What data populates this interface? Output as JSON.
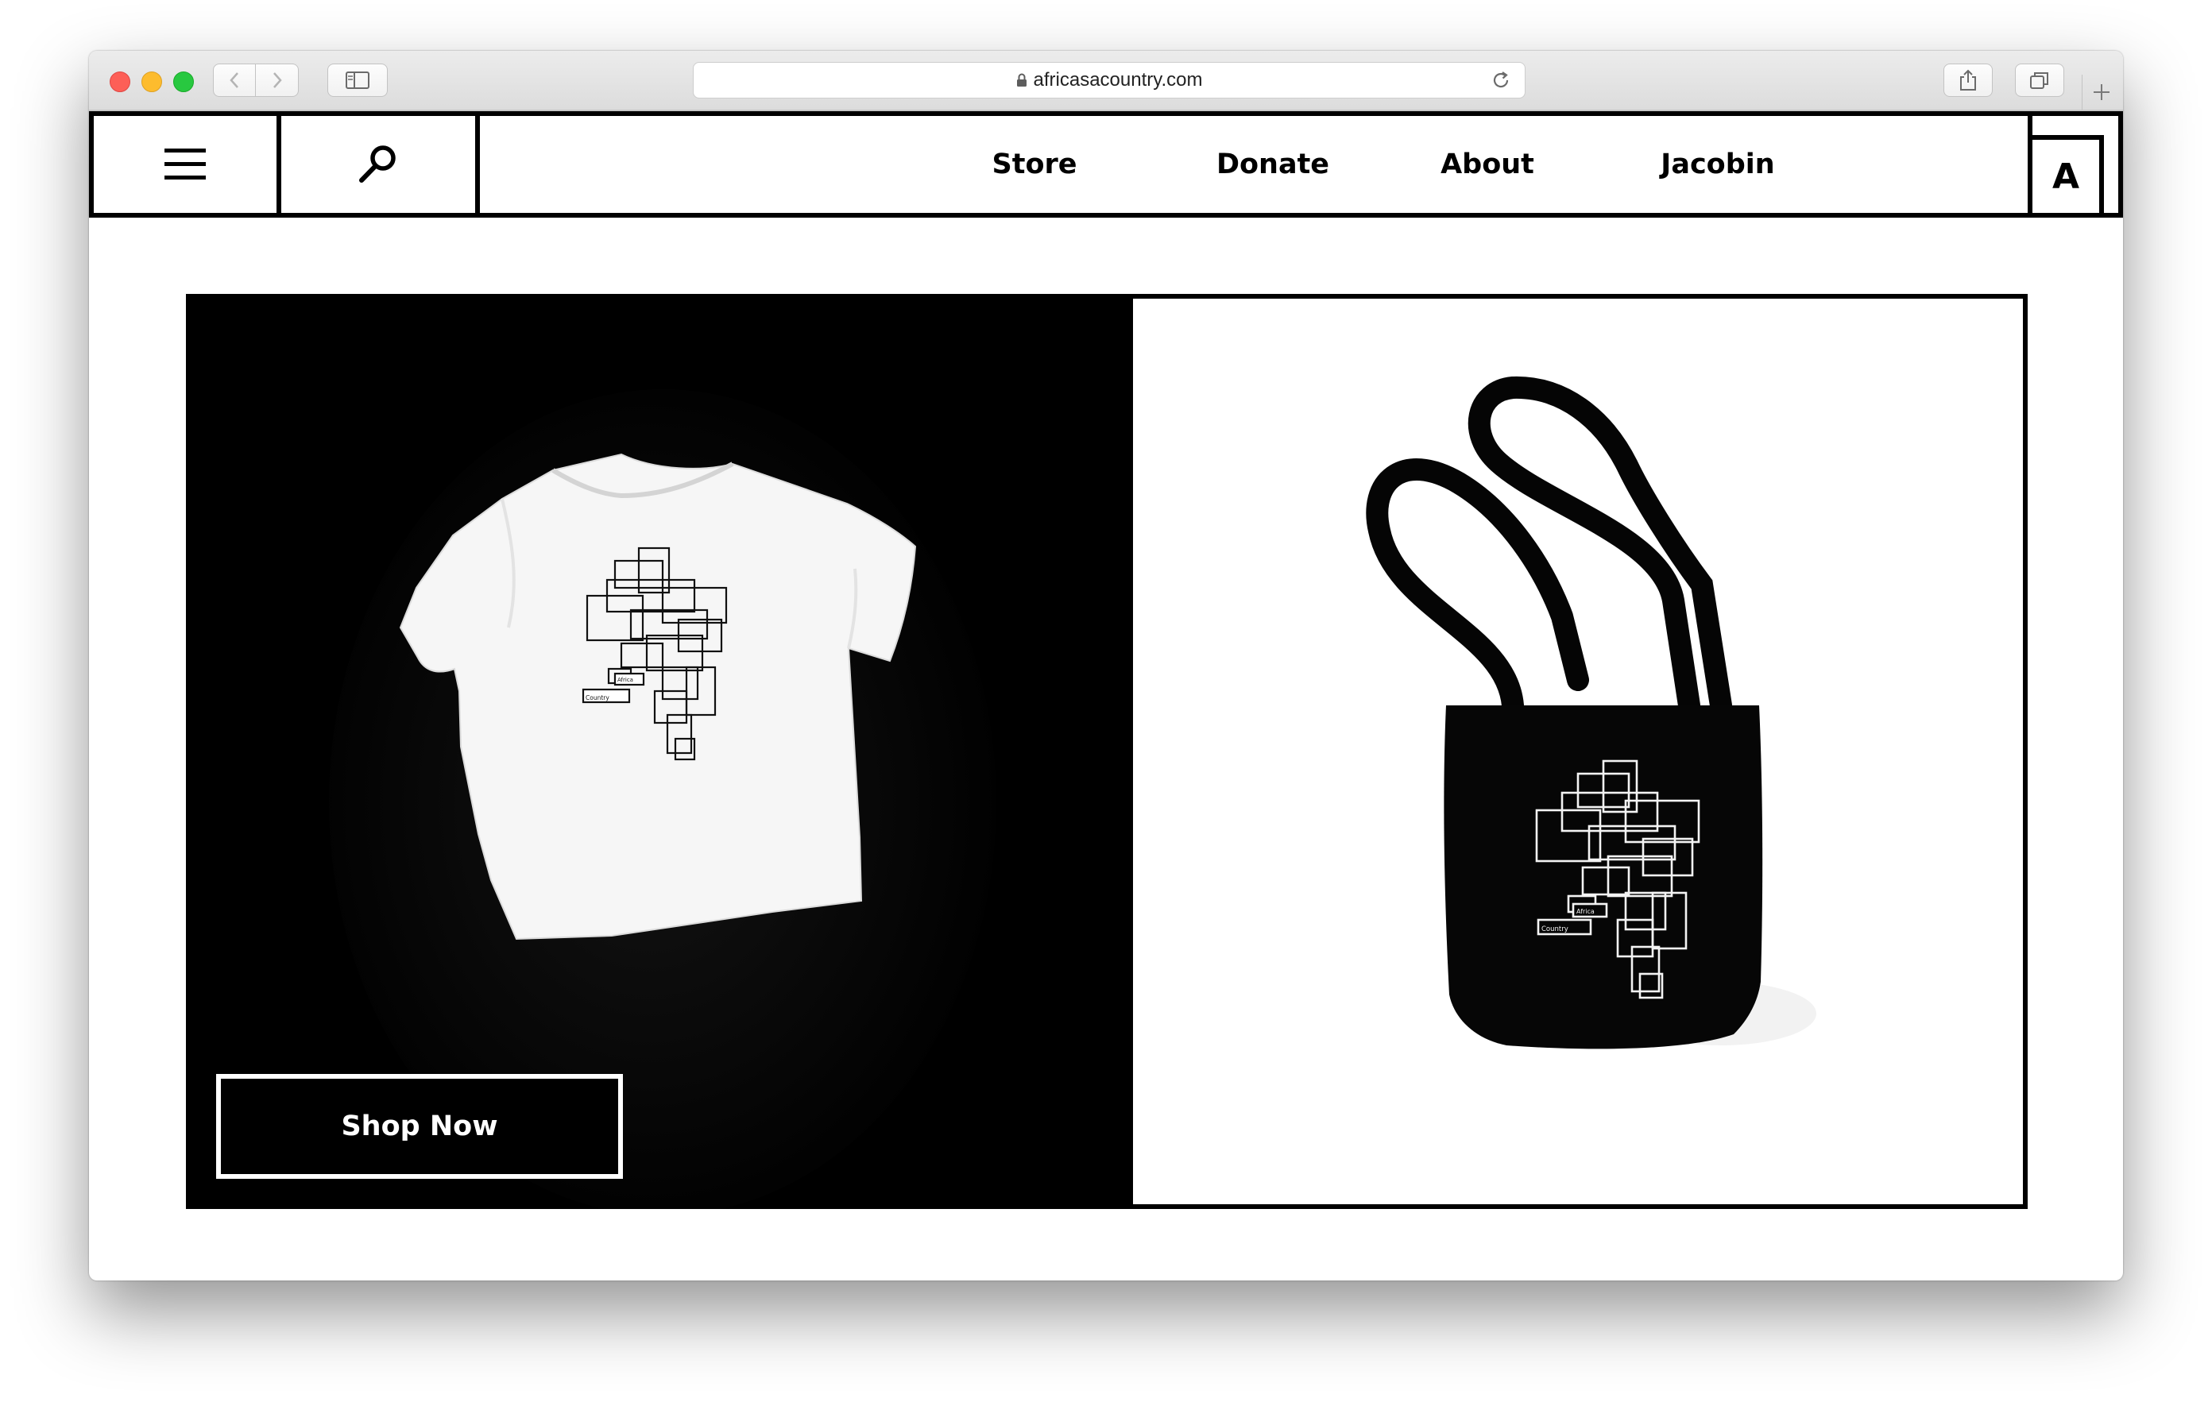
{
  "browser": {
    "url": "africasacountry.com",
    "icons": [
      "chevron-left-icon",
      "chevron-right-icon",
      "sidebar-icon",
      "lock-icon",
      "reload-icon",
      "share-icon",
      "tabs-icon",
      "plus-icon"
    ]
  },
  "header": {
    "menu_icon": "hamburger-icon",
    "search_icon": "search-icon",
    "nav": [
      {
        "label": "Store"
      },
      {
        "label": "Donate"
      },
      {
        "label": "About"
      },
      {
        "label": "Jacobin"
      }
    ],
    "logo": "A"
  },
  "promo": {
    "cta_label": "Shop Now",
    "left_image": "white t-shirt with Africa is a Country map print",
    "right_image": "black tote bag with Africa is a Country map print",
    "print_text": [
      "Africa",
      "is a",
      "Country"
    ]
  },
  "colors": {
    "primary": "#000000",
    "background": "#ffffff"
  }
}
